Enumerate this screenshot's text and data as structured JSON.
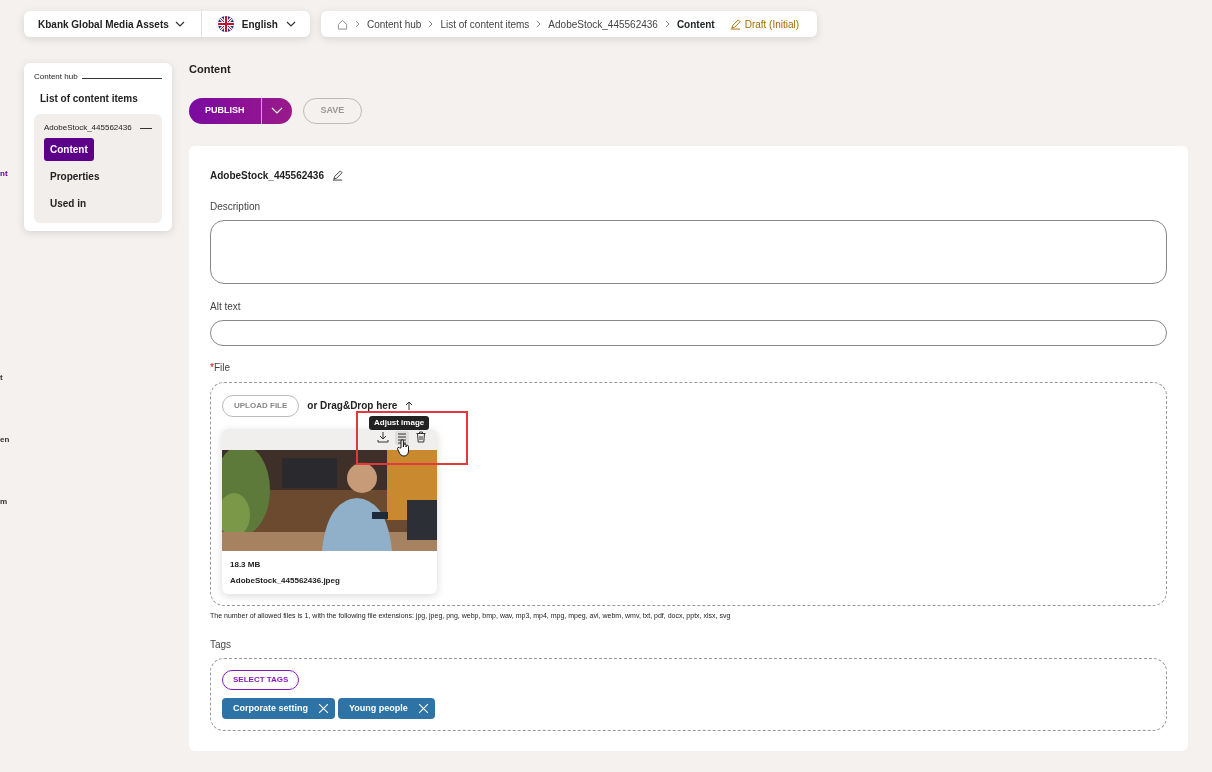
{
  "top_bar": {
    "site": "Kbank Global Media Assets",
    "language": "English"
  },
  "breadcrumb": {
    "items": [
      {
        "label": "Content hub"
      },
      {
        "label": "List of content items"
      },
      {
        "label": "AdobeStock_445562436"
      },
      {
        "label": "Content"
      }
    ],
    "status": "Draft (Initial)"
  },
  "left_edge_fragments": [
    {
      "text": "nt",
      "selected": true
    },
    {
      "text": "t",
      "selected": false
    },
    {
      "text": "en",
      "selected": false
    },
    {
      "text": "m",
      "selected": false
    }
  ],
  "sidebar": {
    "root": "Content hub",
    "list": "List of content items",
    "item": "AdobeStock_445562436",
    "items": [
      {
        "label": "Content",
        "selected": true
      },
      {
        "label": "Properties",
        "selected": false
      },
      {
        "label": "Used in",
        "selected": false
      }
    ]
  },
  "page_title": "Content",
  "actions": {
    "publish": "PUBLISH",
    "save": "SAVE",
    "save_disabled": true
  },
  "form": {
    "title": "AdobeStock_445562436",
    "description_label": "Description",
    "alt_label": "Alt text",
    "file_label": "File",
    "required_mark": "*",
    "upload_button": "UPLOAD FILE",
    "drop_text": "or Drag&Drop here",
    "tooltip": "Adjust image",
    "file": {
      "size": "18.3 MB",
      "name": "AdobeStock_445562436.jpeg"
    },
    "hint": "The number of allowed files is 1, with the following file extensions: jpg, jpeg, png, webp, bmp, wav, mp3, mp4, mpg, mpeg, avi, webm, wmv, txt, pdf, docx, pptx, xlsx, svg",
    "tags_label": "Tags",
    "select_tags": "SELECT TAGS",
    "tags": [
      {
        "label": "Corporate setting"
      },
      {
        "label": "Young people"
      }
    ]
  }
}
